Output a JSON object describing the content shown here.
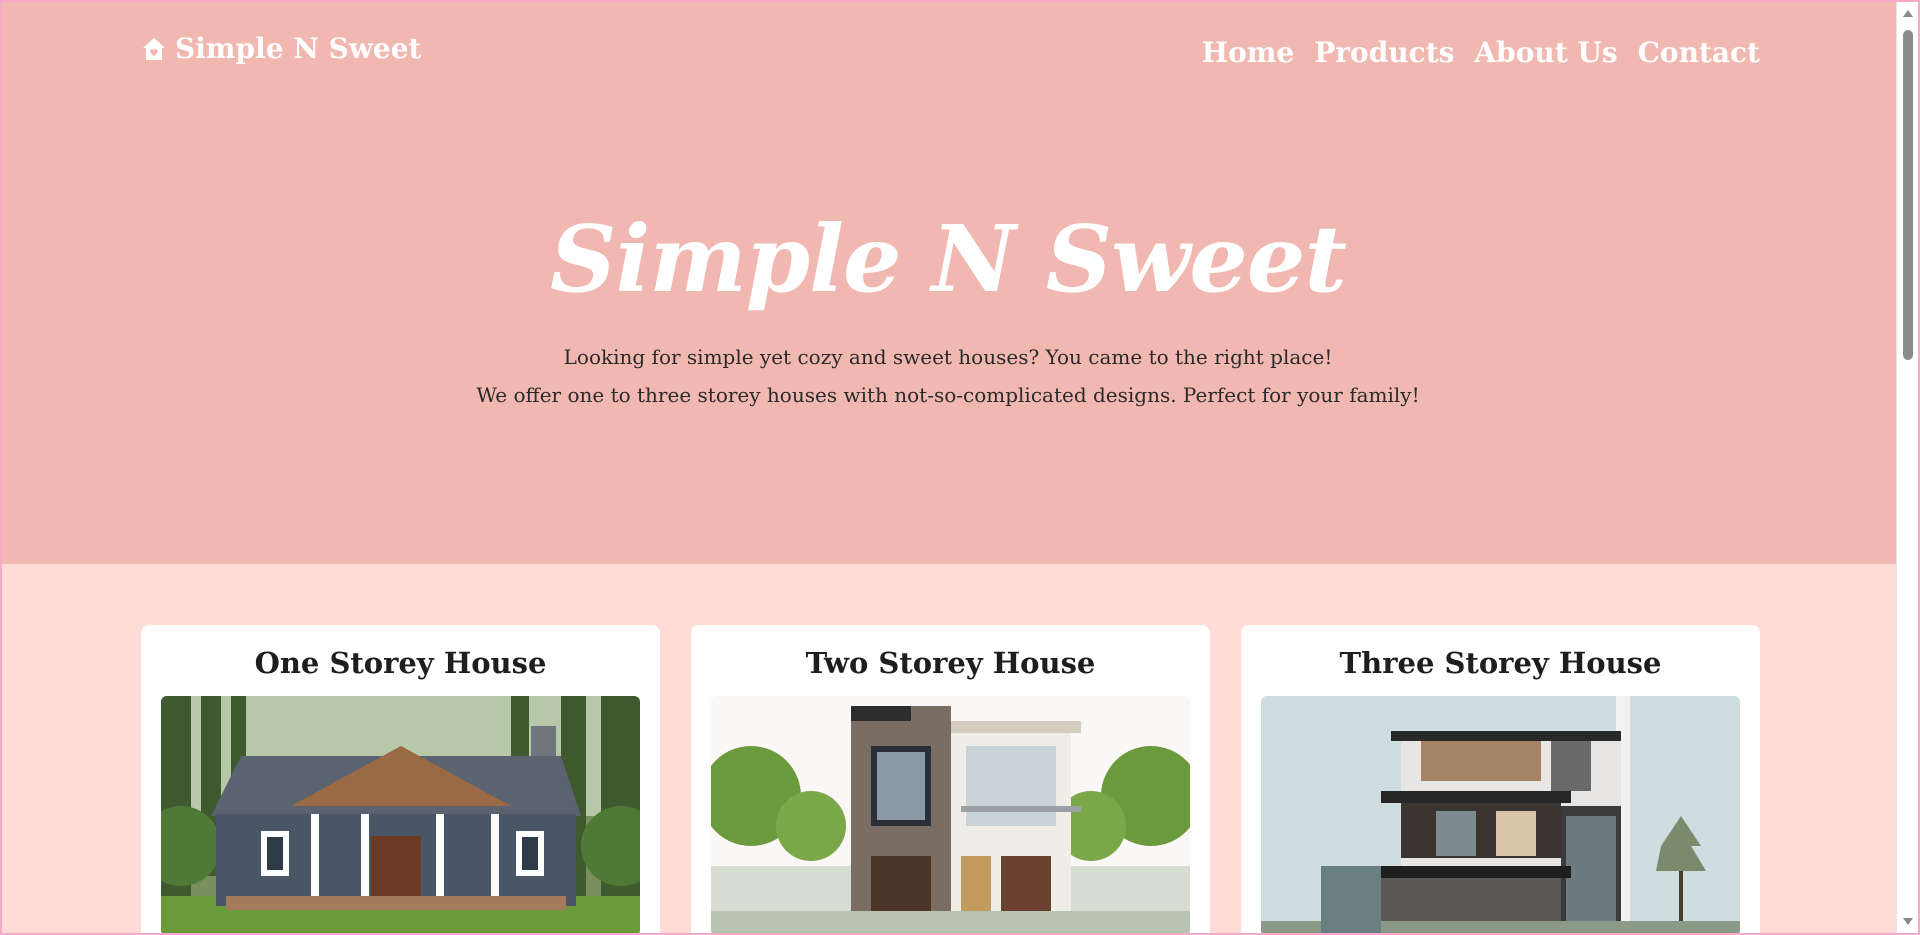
{
  "brand": {
    "name": "Simple N Sweet",
    "icon": "home-heart-icon"
  },
  "nav": [
    {
      "label": "Home"
    },
    {
      "label": "Products"
    },
    {
      "label": "About Us"
    },
    {
      "label": "Contact"
    }
  ],
  "hero": {
    "title": "Simple N Sweet",
    "line1": "Looking for simple yet cozy and sweet houses? You came to the right place!",
    "line2": "We offer one to three storey houses with not-so-complicated designs. Perfect for your family!"
  },
  "products": [
    {
      "title": "One Storey House"
    },
    {
      "title": "Two Storey House"
    },
    {
      "title": "Three Storey House"
    }
  ],
  "colors": {
    "hero_bg": "#f1b8b1",
    "page_bg": "#ffdcd8",
    "text_white": "#ffffff"
  }
}
